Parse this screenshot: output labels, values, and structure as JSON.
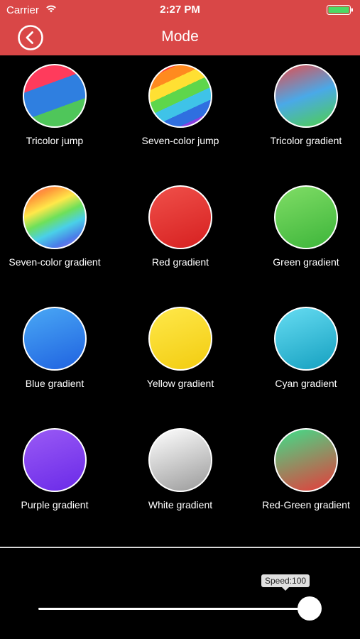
{
  "status_bar": {
    "carrier": "Carrier",
    "time": "2:27 PM"
  },
  "nav": {
    "title": "Mode",
    "back_icon": "chevron-left-circle-icon",
    "bar_color": "#d94747"
  },
  "modes": [
    {
      "label": "Tricolor jump",
      "style": "linear-gradient(160deg, #ff3b5c 0%, #ff3b5c 33%, #2f7fe0 33%, #2f7fe0 66%, #4fc65a 66%, #4fc65a 100%)"
    },
    {
      "label": "Seven-color jump",
      "style": "linear-gradient(155deg, #ff3b3b 0%, #ff3b3b 14%, #ff8a1f 14%, #ff8a1f 28%, #ffe033 28%, #ffe033 42%, #5ed64b 42%, #5ed64b 56%, #3fc3e8 56%, #3fc3e8 70%, #2f6fe0 70%, #2f6fe0 84%, #8a3fe0 84%, #8a3fe0 100%)"
    },
    {
      "label": "Tricolor gradient",
      "style": "linear-gradient(160deg, #e84a4a 0%, #4aa9e8 50%, #4fd04a 100%)"
    },
    {
      "label": "Seven-color gradient",
      "style": "linear-gradient(155deg, #ff5a5a 0%, #ff9a3a 18%, #ffe84a 34%, #6ee05a 50%, #4ad0e8 66%, #4a7fe8 82%, #a05ae8 100%)"
    },
    {
      "label": "Red gradient",
      "style": "linear-gradient(160deg, #f0504a 0%, #d62020 100%)"
    },
    {
      "label": "Green gradient",
      "style": "linear-gradient(160deg, #80dd66 0%, #3db53a 100%)"
    },
    {
      "label": "Blue gradient",
      "style": "linear-gradient(160deg, #4aa8f5 0%, #1f62e0 100%)"
    },
    {
      "label": "Yellow gradient",
      "style": "linear-gradient(160deg, #ffe84a 0%, #f2cc10 100%)"
    },
    {
      "label": "Cyan gradient",
      "style": "linear-gradient(160deg, #66dcf2 0%, #15a0c0 100%)"
    },
    {
      "label": "Purple gradient",
      "style": "linear-gradient(160deg, #9a5af5 0%, #6a2ae8 100%)"
    },
    {
      "label": "White gradient",
      "style": "linear-gradient(160deg, #ffffff 0%, #9a9a9a 100%)"
    },
    {
      "label": "Red-Green gradient",
      "style": "linear-gradient(160deg, #3ee08a 0%, #e83a3a 100%)"
    }
  ],
  "speed": {
    "tooltip": "Speed:100",
    "value": 100,
    "max": 100
  }
}
